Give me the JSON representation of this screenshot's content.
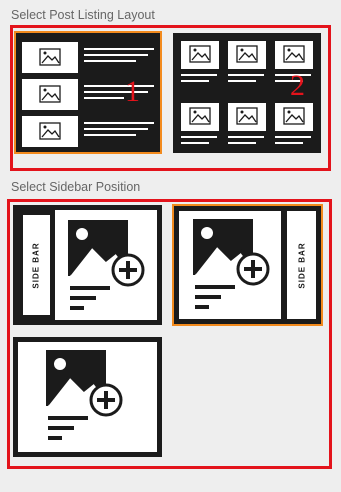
{
  "listing_section": {
    "title": "Select Post Listing Layout",
    "options": [
      {
        "id": "list",
        "marker": "1",
        "selected": true
      },
      {
        "id": "grid",
        "marker": "2",
        "selected": false
      }
    ]
  },
  "sidebar_section": {
    "title": "Select Sidebar Position",
    "options": [
      {
        "id": "left-sidebar",
        "sidebar_label": "SIDE BAR",
        "selected": false
      },
      {
        "id": "right-sidebar",
        "sidebar_label": "SIDE BAR",
        "selected": true
      },
      {
        "id": "no-sidebar",
        "selected": false
      }
    ]
  },
  "colors": {
    "background": "#eeeeee",
    "highlight_frame": "#e3131b",
    "selected_border": "#f28a1d",
    "tile_dark": "#1b1b1b"
  },
  "icons": [
    "image-placeholder-icon",
    "add-image-icon"
  ]
}
